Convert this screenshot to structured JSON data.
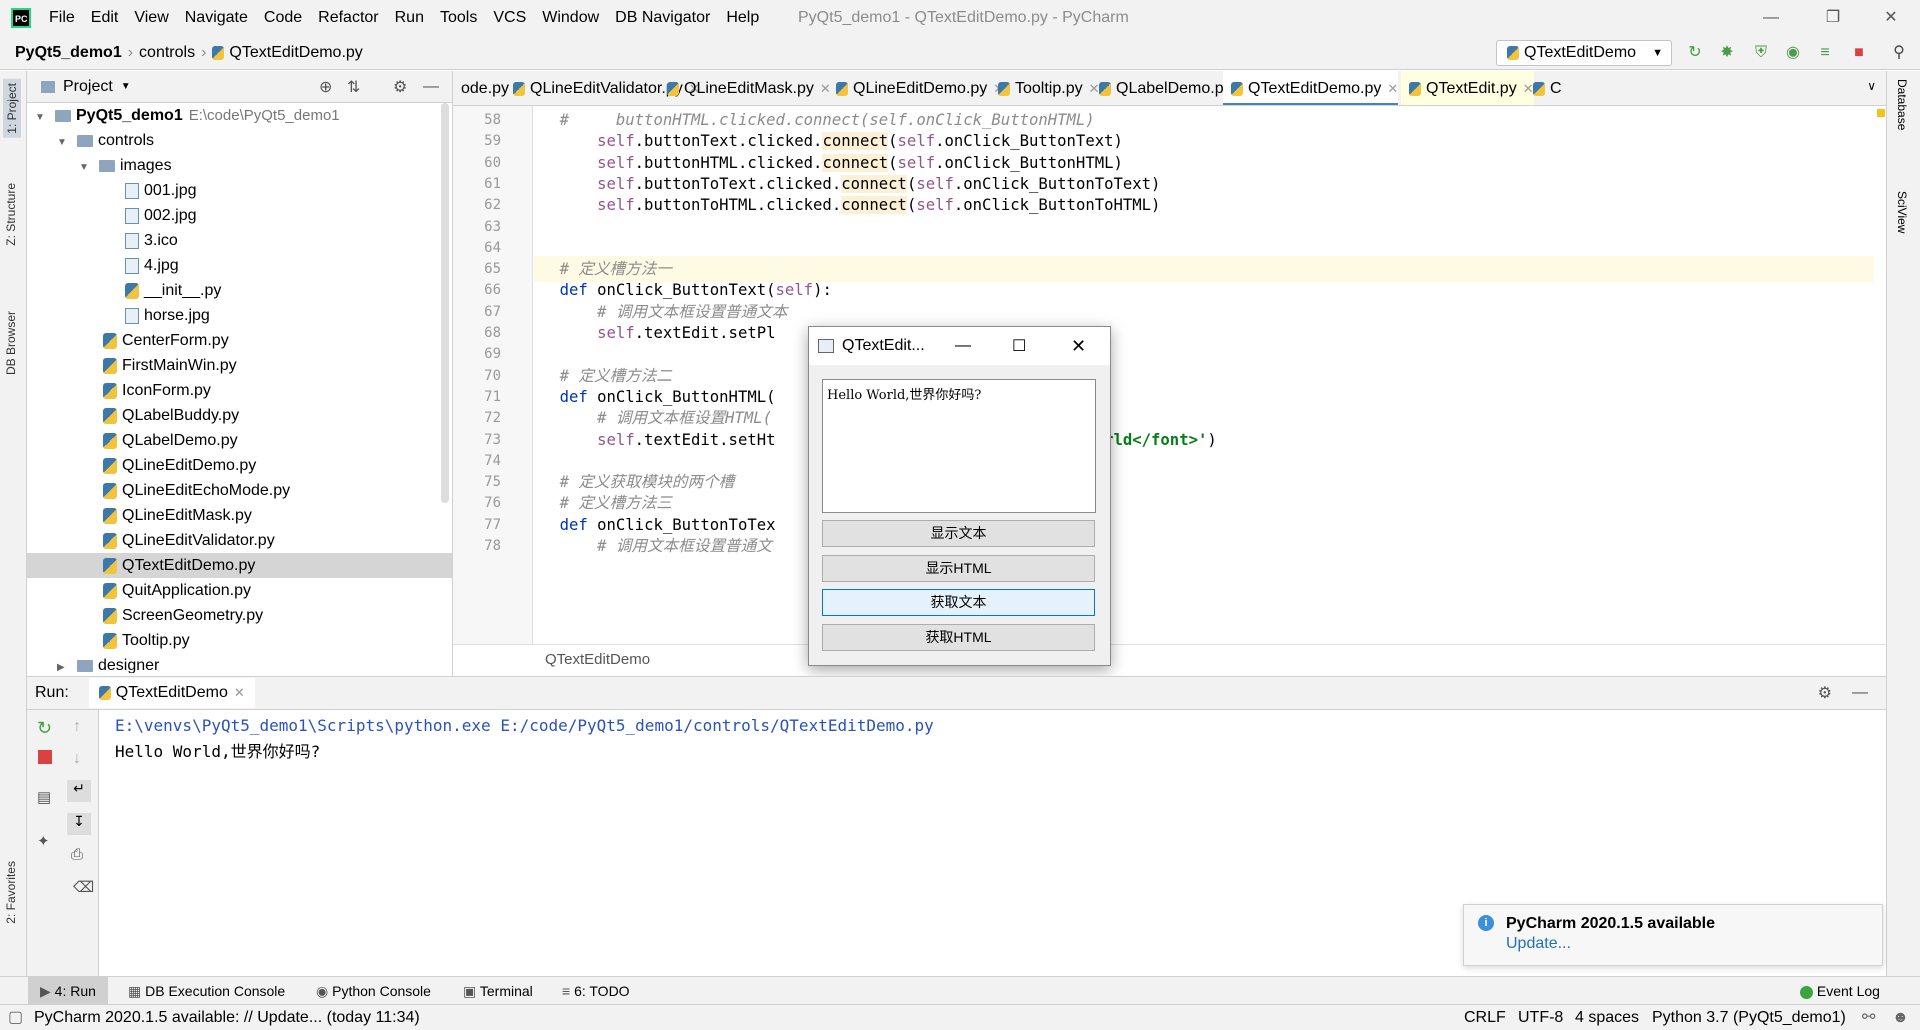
{
  "titlebar": {
    "logo": "PC",
    "menu": [
      "File",
      "Edit",
      "View",
      "Navigate",
      "Code",
      "Refactor",
      "Run",
      "Tools",
      "VCS",
      "Window",
      "DB Navigator",
      "Help"
    ],
    "title": "PyQt5_demo1 - QTextEditDemo.py - PyCharm"
  },
  "navbar": {
    "crumbs": [
      "PyQt5_demo1",
      "controls",
      "QTextEditDemo.py"
    ],
    "run_config": "QTextEditDemo"
  },
  "left_strip": {
    "tabs": [
      "1: Project",
      "Z: Structure",
      "DB Browser",
      "2: Favorites"
    ]
  },
  "right_strip": {
    "tabs": [
      "Database",
      "SciView"
    ]
  },
  "project": {
    "header": "Project",
    "tree": [
      {
        "label": "PyQt5_demo1",
        "suffix": "E:\\code\\PyQt5_demo1",
        "type": "folder",
        "indent": 0,
        "bold": true
      },
      {
        "label": "controls",
        "type": "folder",
        "indent": 1
      },
      {
        "label": "images",
        "type": "folder",
        "indent": 2
      },
      {
        "label": "001.jpg",
        "type": "img",
        "indent": 3
      },
      {
        "label": "002.jpg",
        "type": "img",
        "indent": 3
      },
      {
        "label": "3.ico",
        "type": "img",
        "indent": 3
      },
      {
        "label": "4.jpg",
        "type": "img",
        "indent": 3
      },
      {
        "label": "__init__.py",
        "type": "py",
        "indent": 3
      },
      {
        "label": "horse.jpg",
        "type": "img",
        "indent": 3
      },
      {
        "label": "CenterForm.py",
        "type": "py",
        "indent": 2
      },
      {
        "label": "FirstMainWin.py",
        "type": "py",
        "indent": 2
      },
      {
        "label": "IconForm.py",
        "type": "py",
        "indent": 2
      },
      {
        "label": "QLabelBuddy.py",
        "type": "py",
        "indent": 2
      },
      {
        "label": "QLabelDemo.py",
        "type": "py",
        "indent": 2
      },
      {
        "label": "QLineEditDemo.py",
        "type": "py",
        "indent": 2
      },
      {
        "label": "QLineEditEchoMode.py",
        "type": "py",
        "indent": 2
      },
      {
        "label": "QLineEditMask.py",
        "type": "py",
        "indent": 2
      },
      {
        "label": "QLineEditValidator.py",
        "type": "py",
        "indent": 2
      },
      {
        "label": "QTextEditDemo.py",
        "type": "py",
        "indent": 2,
        "selected": true
      },
      {
        "label": "QuitApplication.py",
        "type": "py",
        "indent": 2
      },
      {
        "label": "ScreenGeometry.py",
        "type": "py",
        "indent": 2
      },
      {
        "label": "Tooltip.py",
        "type": "py",
        "indent": 2
      },
      {
        "label": "designer",
        "type": "folder",
        "indent": 1
      }
    ]
  },
  "editor": {
    "tabs": [
      "ode.py",
      "QLineEditValidator.py",
      "QLineEditMask.py",
      "QLineEditDemo.py",
      "Tooltip.py",
      "QLabelDemo.py",
      "QTextEditDemo.py",
      "QTextEdit.py",
      "C"
    ],
    "active_tab": "QTextEditDemo.py",
    "lines": [
      {
        "n": "58",
        "html": "    <span class=\"cm\">#     buttonHTML.clicked.connect(self.onClick_ButtonHTML)</span>"
      },
      {
        "n": "59",
        "html": "        <span class=\"self\">self</span>.buttonText.clicked.<span class=\"hl\">connect</span>(<span class=\"self\">self</span>.onClick_ButtonText)"
      },
      {
        "n": "60",
        "html": "        <span class=\"self\">self</span>.buttonHTML.clicked.<span class=\"hl\">connect</span>(<span class=\"self\">self</span>.onClick_ButtonHTML)"
      },
      {
        "n": "61",
        "html": "        <span class=\"self\">self</span>.buttonToText.clicked.<span class=\"hl\">connect</span>(<span class=\"self\">self</span>.onClick_ButtonToText)"
      },
      {
        "n": "62",
        "html": "        <span class=\"self\">self</span>.buttonToHTML.clicked.<span class=\"hl\">connect</span>(<span class=\"self\">self</span>.onClick_ButtonToHTML)"
      },
      {
        "n": "63",
        "html": ""
      },
      {
        "n": "64",
        "html": ""
      },
      {
        "n": "65",
        "html": "    <span class=\"cm\"># 定义槽方法一</span>",
        "cur": true
      },
      {
        "n": "66",
        "html": "    <span class=\"kw\">def</span> onClick_ButtonText(<span class=\"self\">self</span>):"
      },
      {
        "n": "67",
        "html": "        <span class=\"cm\"># 调用文本框设置普通文本</span>"
      },
      {
        "n": "68",
        "html": "        <span class=\"self\">self</span>.textEdit.setPl                         ')"
      },
      {
        "n": "69",
        "html": ""
      },
      {
        "n": "70",
        "html": "    <span class=\"cm\"># 定义槽方法二</span>"
      },
      {
        "n": "71",
        "html": "    <span class=\"kw\">def</span> onClick_ButtonHTML("
      },
      {
        "n": "72",
        "html": "        <span class=\"cm\"># 调用文本框设置HTML(</span>"
      },
      {
        "n": "73",
        "html": "        <span class=\"self\">self</span>.textEdit.setHt                         <span class=\"str\">\"&gt;Hello World&lt;/font&gt;'</span>)"
      },
      {
        "n": "74",
        "html": ""
      },
      {
        "n": "75",
        "html": "    <span class=\"cm\"># 定义获取模块的两个槽</span>"
      },
      {
        "n": "76",
        "html": "    <span class=\"cm\"># 定义槽方法三</span>"
      },
      {
        "n": "77",
        "html": "    <span class=\"kw\">def</span> onClick_ButtonToTex"
      },
      {
        "n": "78",
        "html": "        <span class=\"cm\"># 调用文本框设置普通文</span>"
      }
    ],
    "breadcrumb": "QTextEditDemo"
  },
  "qwin": {
    "title": "QTextEdit...",
    "text": "Hello World,世界你好吗?",
    "buttons": [
      "显示文本",
      "显示HTML",
      "获取文本",
      "获取HTML"
    ]
  },
  "run": {
    "label": "Run:",
    "tab": "QTextEditDemo",
    "console": [
      "E:\\venvs\\PyQt5_demo1\\Scripts\\python.exe E:/code/PyQt5_demo1/controls/QTextEditDemo.py",
      "Hello World,世界你好吗?"
    ]
  },
  "notification": {
    "title": "PyCharm 2020.1.5 available",
    "link": "Update..."
  },
  "bottom_tabs": {
    "run": "4: Run",
    "db": "DB Execution Console",
    "python": "Python Console",
    "terminal": "Terminal",
    "todo": "6: TODO",
    "eventlog": "Event Log"
  },
  "status": {
    "message": "PyCharm 2020.1.5 available: // Update... (today 11:34)",
    "line_sep": "CRLF",
    "encoding": "UTF-8",
    "indent": "4 spaces",
    "interpreter": "Python 3.7 (PyQt5_demo1)"
  }
}
